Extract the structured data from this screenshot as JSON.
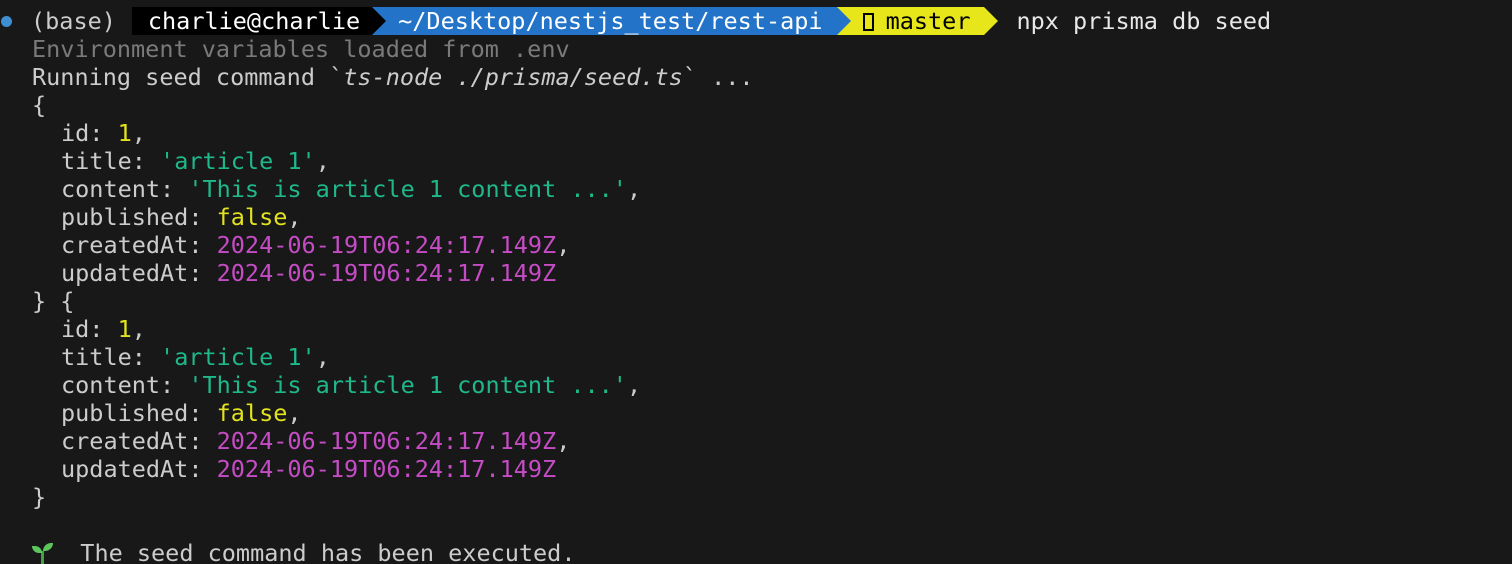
{
  "prompt": {
    "env": "(base)",
    "user": "charlie@charlie",
    "path": "~/Desktop/nestjs_test/rest-api",
    "branch": "master",
    "command": "npx prisma db seed"
  },
  "output": {
    "env_loaded": "Environment variables loaded from .env",
    "running_prefix": "Running seed command `",
    "running_cmd": "ts-node ./prisma/seed.ts",
    "running_suffix": "` ...",
    "records": [
      {
        "open": "{",
        "id": "1",
        "title": "'article 1'",
        "content": "'This is article 1 content ...'",
        "published": "false",
        "createdAt": "2024-06-19T06:24:17.149Z",
        "updatedAt": "2024-06-19T06:24:17.149Z"
      },
      {
        "open": "} {",
        "id": "1",
        "title": "'article 1'",
        "content": "'This is article 1 content ...'",
        "published": "false",
        "createdAt": "2024-06-19T06:24:17.149Z",
        "updatedAt": "2024-06-19T06:24:17.149Z"
      }
    ],
    "close": "}",
    "done_message": "The seed command has been executed."
  },
  "keys": {
    "id": "id: ",
    "title": "title: ",
    "content": "content: ",
    "published": "published: ",
    "createdAt": "createdAt: ",
    "updatedAt": "updatedAt: ",
    "comma": ","
  },
  "icons": {
    "status": "status-dot-icon",
    "branch": "git-branch-icon",
    "done": "seedling-icon"
  },
  "colors": {
    "background": "#181818",
    "dir_segment": "#2374c8",
    "git_segment": "#e6e61a",
    "number": "#e2e21f",
    "string": "#1fb88a",
    "date": "#c64cc6"
  }
}
